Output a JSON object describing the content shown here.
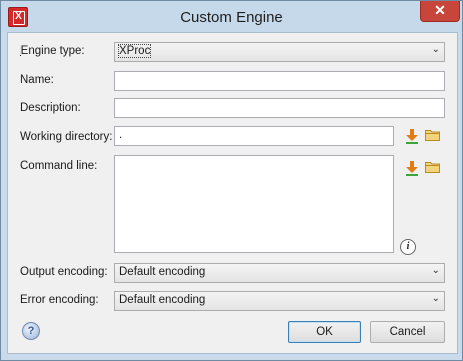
{
  "window": {
    "title": "Custom Engine",
    "app_icon_letter": "X"
  },
  "close_glyph": "✕",
  "fields": {
    "engine_type": {
      "label": "Engine type:",
      "value": "XProc"
    },
    "name": {
      "label": "Name:",
      "value": ""
    },
    "description": {
      "label": "Description:",
      "value": ""
    },
    "working_directory": {
      "label": "Working directory:",
      "value": "."
    },
    "command_line": {
      "label": "Command line:",
      "value": ""
    },
    "output_encoding": {
      "label": "Output encoding:",
      "value": "Default encoding"
    },
    "error_encoding": {
      "label": "Error encoding:",
      "value": "Default encoding"
    }
  },
  "buttons": {
    "ok": "OK",
    "cancel": "Cancel"
  },
  "icons": {
    "insert_editor_variables": "download-arrow-icon",
    "browse": "folder-icon",
    "info": "info-icon",
    "help": "help-icon"
  },
  "colors": {
    "titlebar": "#c6d9ea",
    "close_button": "#c8453b",
    "default_button_border": "#3c7fb1"
  }
}
